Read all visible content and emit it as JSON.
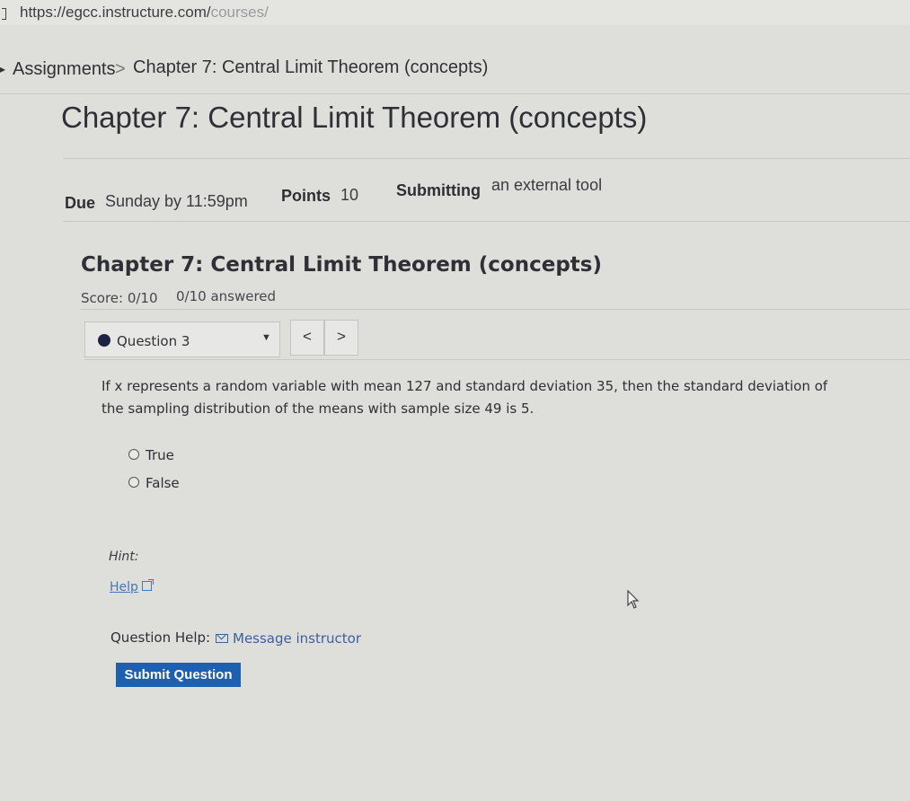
{
  "browser": {
    "url": "https://egcc.instructure.com/",
    "url_tail": "courses/"
  },
  "breadcrumb": {
    "items": [
      "Assignments",
      "Chapter 7: Central Limit Theorem (concepts)"
    ],
    "separator": ">"
  },
  "assignment": {
    "title": "Chapter 7: Central Limit Theorem (concepts)",
    "due_label": "Due",
    "due_value": "Sunday by 11:59pm",
    "points_label": "Points",
    "points_value": "10",
    "submitting_label": "Submitting",
    "submitting_value": "an external tool"
  },
  "quiz": {
    "title": "Chapter 7: Central Limit Theorem (concepts)",
    "score": "Score: 0/10",
    "answered": "0/10 answered",
    "question_selector": "Question 3",
    "prev_label": "<",
    "next_label": ">",
    "question_text": "If x represents a random variable with mean 127 and standard deviation 35, then the standard deviation of the sampling distribution of the means with sample size 49 is 5.",
    "options": [
      "True",
      "False"
    ],
    "hint_label": "Hint:",
    "help_link": "Help",
    "question_help_label": "Question Help:",
    "message_instructor": "Message instructor",
    "submit_label": "Submit Question"
  },
  "colors": {
    "accent": "#1f5fb0",
    "link": "#4a74b6",
    "question_bullet": "#1d2340"
  },
  "icons": [
    "external-link-icon",
    "mail-icon",
    "mouse-cursor-icon",
    "caret-down-icon"
  ]
}
